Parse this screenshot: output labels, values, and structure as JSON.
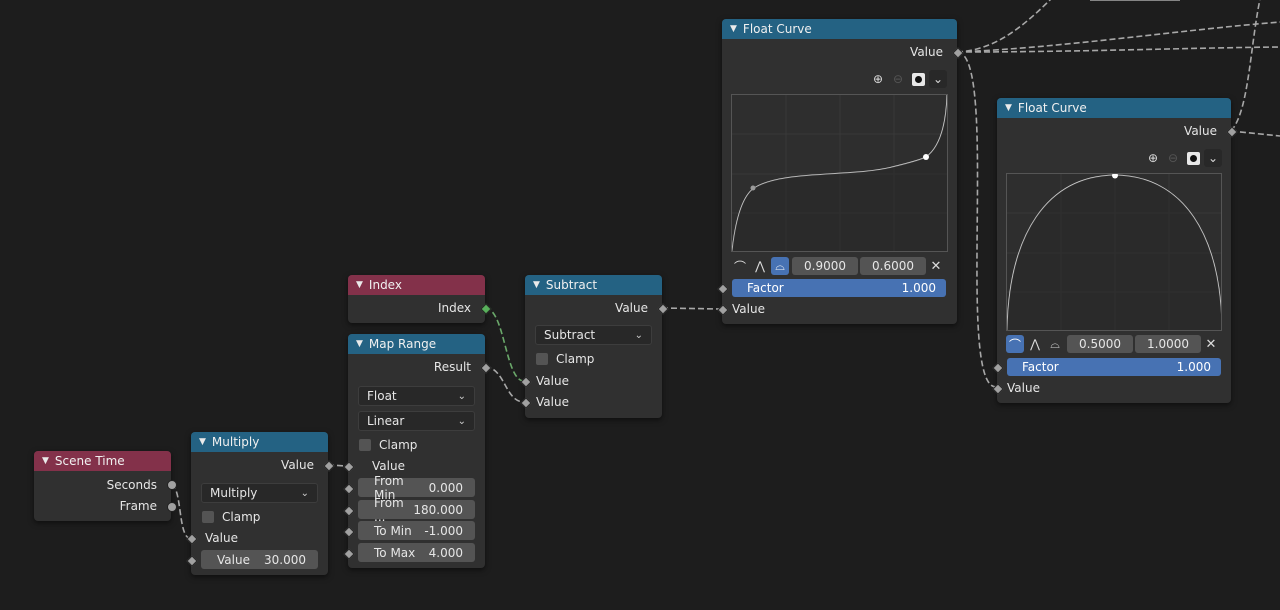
{
  "nodes": {
    "scene_time": {
      "title": "Scene Time",
      "outputs": [
        "Seconds",
        "Frame"
      ]
    },
    "multiply": {
      "title": "Multiply",
      "output": "Value",
      "operation": "Multiply",
      "clamp_label": "Clamp",
      "input_label": "Value",
      "value_label": "Value",
      "value": "30.000"
    },
    "index": {
      "title": "Index",
      "output": "Index"
    },
    "map_range": {
      "title": "Map Range",
      "output": "Result",
      "data_type": "Float",
      "interpolation": "Linear",
      "clamp_label": "Clamp",
      "input_label": "Value",
      "fields": [
        {
          "label": "From Min",
          "value": "0.000"
        },
        {
          "label": "From ...",
          "value": "180.000"
        },
        {
          "label": "To Min",
          "value": "-1.000"
        },
        {
          "label": "To Max",
          "value": "4.000"
        }
      ]
    },
    "subtract": {
      "title": "Subtract",
      "output": "Value",
      "operation": "Subtract",
      "clamp_label": "Clamp",
      "inputs": [
        "Value",
        "Value"
      ]
    },
    "float_curve_1": {
      "title": "Float Curve",
      "output": "Value",
      "point_x": "0.9000",
      "point_y": "0.6000",
      "factor_label": "Factor",
      "factor": "1.000",
      "input_label": "Value"
    },
    "float_curve_2": {
      "title": "Float Curve",
      "output": "Value",
      "point_x": "0.5000",
      "point_y": "1.0000",
      "factor_label": "Factor",
      "factor": "1.000",
      "input_label": "Value"
    }
  },
  "icons": {
    "collapse": "chevron-down-icon",
    "zoom_in": "zoom-in-icon",
    "zoom_out": "zoom-out-icon",
    "clip": "clipping-icon",
    "menu": "chevron-down-icon",
    "handle_auto": "handle-auto-icon",
    "handle_vector": "handle-vector-icon",
    "handle_clamped": "handle-auto-clamped-icon",
    "delete": "x-icon"
  },
  "colors": {
    "background": "#1d1d1d",
    "node_body": "#303030",
    "input_header": "#83314a",
    "converter_header": "#246283",
    "factor_bar": "#4772b3",
    "link": "#a8a8a8",
    "int_socket": "#58b05b"
  }
}
